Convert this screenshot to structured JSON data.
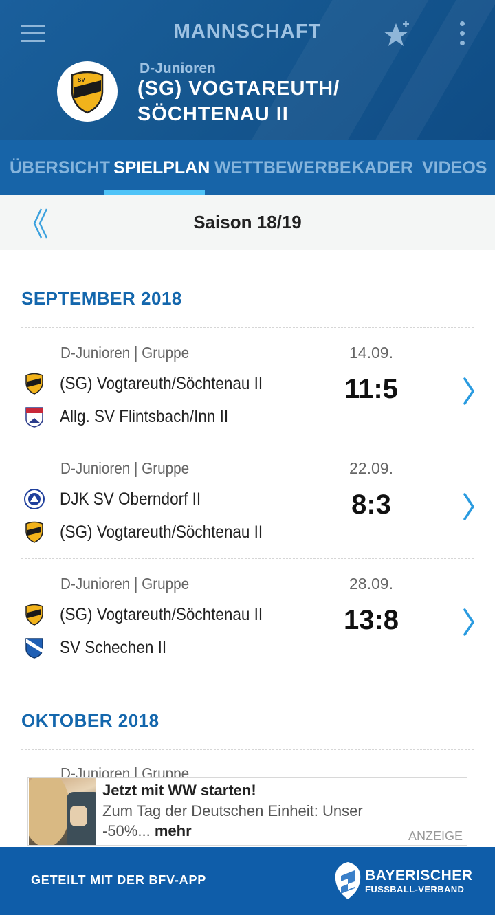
{
  "header": {
    "title": "MANNSCHAFT",
    "menu_icon": "hamburger-menu-icon",
    "favorite_icon": "star-plus-icon",
    "more_icon": "more-vertical-icon",
    "team_category": "D-Junioren",
    "team_name_line1": "(SG) VOGTAREUTH/",
    "team_name_line2": "SÖCHTENAU II"
  },
  "tabs": [
    {
      "label": "ÜBERSICHT",
      "active": false
    },
    {
      "label": "SPIELPLAN",
      "active": true
    },
    {
      "label": "WETTBEWERBE",
      "active": false
    },
    {
      "label": "KADER",
      "active": false
    },
    {
      "label": "VIDEOS",
      "active": false
    }
  ],
  "season": {
    "label": "Saison 18/19"
  },
  "months": [
    {
      "label": "SEPTEMBER 2018",
      "matches": [
        {
          "league": "D-Junioren | Gruppe",
          "date": "14.09.",
          "home": "(SG) Vogtareuth/Söchtenau II",
          "away": "Allg. SV Flintsbach/Inn II",
          "score": "11:5"
        },
        {
          "league": "D-Junioren | Gruppe",
          "date": "22.09.",
          "home": "DJK SV Oberndorf II",
          "away": "(SG) Vogtareuth/Söchtenau II",
          "score": "8:3"
        },
        {
          "league": "D-Junioren | Gruppe",
          "date": "28.09.",
          "home": "(SG) Vogtareuth/Söchtenau II",
          "away": "SV Schechen II",
          "score": "13:8"
        }
      ]
    },
    {
      "label": "OKTOBER 2018",
      "matches": [
        {
          "league": "D-Junioren | Gruppe"
        }
      ]
    }
  ],
  "ad": {
    "title": "Jetzt mit WW starten!",
    "text": "Zum Tag der Deutschen Einheit: Unser -50%...",
    "more": "mehr",
    "tag": "ANZEIGE"
  },
  "footer": {
    "shared": "GETEILT MIT DER BFV-APP",
    "brand_line1": "BAYERISCHER",
    "brand_line2": "FUSSBALL-VERBAND"
  },
  "colors": {
    "header_bg": "#165891",
    "tab_bg": "#1764a8",
    "tab_indicator": "#4fc3f7",
    "month_heading": "#1467ad",
    "chevron": "#2a9be0",
    "footer_bg": "#0f5da9"
  }
}
